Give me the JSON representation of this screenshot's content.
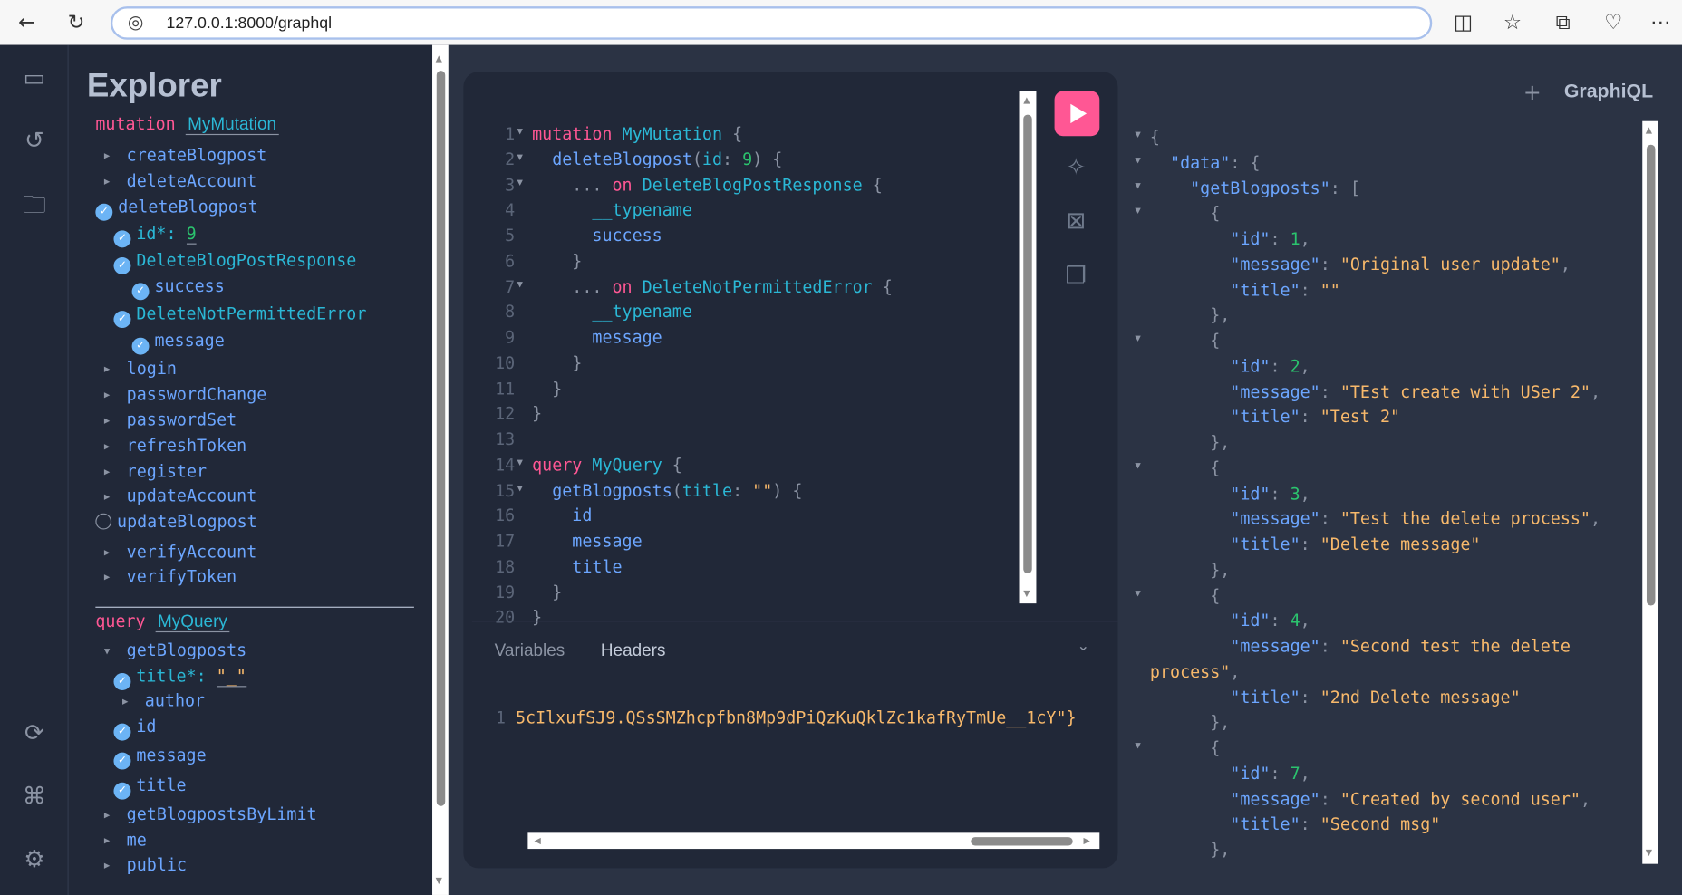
{
  "browser": {
    "url": "127.0.0.1:8000/graphql",
    "icons": [
      "back-arrow-icon",
      "reload-icon",
      "globe-icon",
      "split-screen-icon",
      "favorites-icon",
      "collections-icon",
      "browser-essentials-icon",
      "more-icon"
    ]
  },
  "sidebar": {
    "icons": [
      "docs-icon",
      "history-icon",
      "explorer-icon",
      "refetch-schema-icon",
      "shortcuts-icon",
      "settings-icon"
    ]
  },
  "explorer": {
    "title": "Explorer",
    "mutation": {
      "keyword": "mutation",
      "name": "MyMutation"
    },
    "mutation_items": [
      {
        "label": "createBlogpost",
        "state": "collapsed",
        "level": 0
      },
      {
        "label": "deleteAccount",
        "state": "collapsed",
        "level": 0
      },
      {
        "label": "deleteBlogpost",
        "state": "checked",
        "level": 0
      },
      {
        "label": "id*: ",
        "value": "9",
        "state": "checked",
        "level": 1,
        "arg": true
      },
      {
        "label": "DeleteBlogPostResponse",
        "state": "checked",
        "level": 1,
        "type": true
      },
      {
        "label": "success",
        "state": "checked",
        "level": 2
      },
      {
        "label": "DeleteNotPermittedError",
        "state": "checked",
        "level": 1,
        "type": true
      },
      {
        "label": "message",
        "state": "checked",
        "level": 2
      },
      {
        "label": "login",
        "state": "collapsed",
        "level": 0
      },
      {
        "label": "passwordChange",
        "state": "collapsed",
        "level": 0
      },
      {
        "label": "passwordSet",
        "state": "collapsed",
        "level": 0
      },
      {
        "label": "refreshToken",
        "state": "collapsed",
        "level": 0
      },
      {
        "label": "register",
        "state": "collapsed",
        "level": 0
      },
      {
        "label": "updateAccount",
        "state": "collapsed",
        "level": 0
      },
      {
        "label": "updateBlogpost",
        "state": "unchecked",
        "level": 0
      },
      {
        "label": "verifyAccount",
        "state": "collapsed",
        "level": 0
      },
      {
        "label": "verifyToken",
        "state": "collapsed",
        "level": 0
      }
    ],
    "query": {
      "keyword": "query",
      "name": "MyQuery"
    },
    "query_items": [
      {
        "label": "getBlogposts",
        "state": "expanded",
        "level": 0
      },
      {
        "label": "title*: ",
        "value": "\"_\"",
        "state": "checked",
        "level": 1,
        "arg": true
      },
      {
        "label": "author",
        "state": "collapsed",
        "level": 1
      },
      {
        "label": "id",
        "state": "checked",
        "level": 1
      },
      {
        "label": "message",
        "state": "checked",
        "level": 1
      },
      {
        "label": "title",
        "state": "checked",
        "level": 1
      },
      {
        "label": "getBlogpostsByLimit",
        "state": "collapsed",
        "level": 0
      },
      {
        "label": "me",
        "state": "collapsed",
        "level": 0
      },
      {
        "label": "public",
        "state": "collapsed",
        "level": 0
      }
    ]
  },
  "editor": {
    "lines": [
      {
        "fold": true,
        "tokens": [
          [
            "kw",
            "mutation"
          ],
          [
            "pn",
            " "
          ],
          [
            "nm",
            "MyMutation"
          ],
          [
            "pn",
            " {"
          ]
        ]
      },
      {
        "fold": true,
        "tokens": [
          [
            "pn",
            "  "
          ],
          [
            "fld",
            "deleteBlogpost"
          ],
          [
            "pn",
            "("
          ],
          [
            "arg",
            "id"
          ],
          [
            "pn",
            ": "
          ],
          [
            "num",
            "9"
          ],
          [
            "pn",
            ") {"
          ]
        ]
      },
      {
        "fold": true,
        "tokens": [
          [
            "pn",
            "    ... "
          ],
          [
            "kw",
            "on"
          ],
          [
            "pn",
            " "
          ],
          [
            "nm",
            "DeleteBlogPostResponse"
          ],
          [
            "pn",
            " {"
          ]
        ]
      },
      {
        "fold": false,
        "tokens": [
          [
            "pn",
            "      "
          ],
          [
            "nm",
            "__typename"
          ]
        ]
      },
      {
        "fold": false,
        "tokens": [
          [
            "pn",
            "      "
          ],
          [
            "fld",
            "success"
          ]
        ]
      },
      {
        "fold": false,
        "tokens": [
          [
            "pn",
            "    }"
          ]
        ]
      },
      {
        "fold": true,
        "tokens": [
          [
            "pn",
            "    ... "
          ],
          [
            "kw",
            "on"
          ],
          [
            "pn",
            " "
          ],
          [
            "nm",
            "DeleteNotPermittedError"
          ],
          [
            "pn",
            " {"
          ]
        ]
      },
      {
        "fold": false,
        "tokens": [
          [
            "pn",
            "      "
          ],
          [
            "nm",
            "__typename"
          ]
        ]
      },
      {
        "fold": false,
        "tokens": [
          [
            "pn",
            "      "
          ],
          [
            "fld",
            "message"
          ]
        ]
      },
      {
        "fold": false,
        "tokens": [
          [
            "pn",
            "    }"
          ]
        ]
      },
      {
        "fold": false,
        "tokens": [
          [
            "pn",
            "  }"
          ]
        ]
      },
      {
        "fold": false,
        "tokens": [
          [
            "pn",
            "}"
          ]
        ]
      },
      {
        "fold": false,
        "tokens": []
      },
      {
        "fold": true,
        "tokens": [
          [
            "kw",
            "query"
          ],
          [
            "pn",
            " "
          ],
          [
            "nm",
            "MyQuery"
          ],
          [
            "pn",
            " {"
          ]
        ]
      },
      {
        "fold": true,
        "tokens": [
          [
            "pn",
            "  "
          ],
          [
            "fld",
            "getBlogposts"
          ],
          [
            "pn",
            "("
          ],
          [
            "arg",
            "title"
          ],
          [
            "pn",
            ": "
          ],
          [
            "str",
            "\"\""
          ],
          [
            "pn",
            ") {"
          ]
        ]
      },
      {
        "fold": false,
        "tokens": [
          [
            "pn",
            "    "
          ],
          [
            "fld",
            "id"
          ]
        ]
      },
      {
        "fold": false,
        "tokens": [
          [
            "pn",
            "    "
          ],
          [
            "fld",
            "message"
          ]
        ]
      },
      {
        "fold": false,
        "tokens": [
          [
            "pn",
            "    "
          ],
          [
            "fld",
            "title"
          ]
        ]
      },
      {
        "fold": false,
        "tokens": [
          [
            "pn",
            "  }"
          ]
        ]
      },
      {
        "fold": false,
        "tokens": [
          [
            "pn",
            "}"
          ]
        ]
      }
    ],
    "toolbar": {
      "run": "run-icon",
      "prettify": "prettify-icon",
      "merge": "merge-fragments-icon",
      "copy": "copy-icon"
    },
    "tabs": [
      "Variables",
      "Headers"
    ],
    "headers_line_number": "1",
    "headers_text": "5cIlxufSJ9.QSsSMZhcpfbn8Mp9dPiQzKuQklZc1kafRyTmUe__1cY\"}"
  },
  "results": {
    "add_tab": "+",
    "logo": "GraphiQL",
    "lines": [
      {
        "fold": true,
        "tokens": [
          [
            "pn",
            "{"
          ]
        ]
      },
      {
        "fold": true,
        "tokens": [
          [
            "pn",
            "  "
          ],
          [
            "key",
            "\"data\""
          ],
          [
            "pn",
            ": {"
          ]
        ]
      },
      {
        "fold": true,
        "tokens": [
          [
            "pn",
            "    "
          ],
          [
            "key",
            "\"getBlogposts\""
          ],
          [
            "pn",
            ": ["
          ]
        ]
      },
      {
        "fold": true,
        "tokens": [
          [
            "pn",
            "      {"
          ]
        ]
      },
      {
        "fold": false,
        "tokens": [
          [
            "pn",
            "        "
          ],
          [
            "key",
            "\"id\""
          ],
          [
            "pn",
            ": "
          ],
          [
            "num",
            "1"
          ],
          [
            "pn",
            ","
          ]
        ]
      },
      {
        "fold": false,
        "tokens": [
          [
            "pn",
            "        "
          ],
          [
            "key",
            "\"message\""
          ],
          [
            "pn",
            ": "
          ],
          [
            "str",
            "\"Original user update\""
          ],
          [
            "pn",
            ","
          ]
        ]
      },
      {
        "fold": false,
        "tokens": [
          [
            "pn",
            "        "
          ],
          [
            "key",
            "\"title\""
          ],
          [
            "pn",
            ": "
          ],
          [
            "str",
            "\"\""
          ]
        ]
      },
      {
        "fold": false,
        "tokens": [
          [
            "pn",
            "      },"
          ]
        ]
      },
      {
        "fold": true,
        "tokens": [
          [
            "pn",
            "      {"
          ]
        ]
      },
      {
        "fold": false,
        "tokens": [
          [
            "pn",
            "        "
          ],
          [
            "key",
            "\"id\""
          ],
          [
            "pn",
            ": "
          ],
          [
            "num",
            "2"
          ],
          [
            "pn",
            ","
          ]
        ]
      },
      {
        "fold": false,
        "tokens": [
          [
            "pn",
            "        "
          ],
          [
            "key",
            "\"message\""
          ],
          [
            "pn",
            ": "
          ],
          [
            "str",
            "\"TEst create with USer 2\""
          ],
          [
            "pn",
            ","
          ]
        ]
      },
      {
        "fold": false,
        "tokens": [
          [
            "pn",
            "        "
          ],
          [
            "key",
            "\"title\""
          ],
          [
            "pn",
            ": "
          ],
          [
            "str",
            "\"Test 2\""
          ]
        ]
      },
      {
        "fold": false,
        "tokens": [
          [
            "pn",
            "      },"
          ]
        ]
      },
      {
        "fold": true,
        "tokens": [
          [
            "pn",
            "      {"
          ]
        ]
      },
      {
        "fold": false,
        "tokens": [
          [
            "pn",
            "        "
          ],
          [
            "key",
            "\"id\""
          ],
          [
            "pn",
            ": "
          ],
          [
            "num",
            "3"
          ],
          [
            "pn",
            ","
          ]
        ]
      },
      {
        "fold": false,
        "tokens": [
          [
            "pn",
            "        "
          ],
          [
            "key",
            "\"message\""
          ],
          [
            "pn",
            ": "
          ],
          [
            "str",
            "\"Test the delete process\""
          ],
          [
            "pn",
            ","
          ]
        ]
      },
      {
        "fold": false,
        "tokens": [
          [
            "pn",
            "        "
          ],
          [
            "key",
            "\"title\""
          ],
          [
            "pn",
            ": "
          ],
          [
            "str",
            "\"Delete message\""
          ]
        ]
      },
      {
        "fold": false,
        "tokens": [
          [
            "pn",
            "      },"
          ]
        ]
      },
      {
        "fold": true,
        "tokens": [
          [
            "pn",
            "      {"
          ]
        ]
      },
      {
        "fold": false,
        "tokens": [
          [
            "pn",
            "        "
          ],
          [
            "key",
            "\"id\""
          ],
          [
            "pn",
            ": "
          ],
          [
            "num",
            "4"
          ],
          [
            "pn",
            ","
          ]
        ]
      },
      {
        "fold": false,
        "tokens": [
          [
            "pn",
            "        "
          ],
          [
            "key",
            "\"message\""
          ],
          [
            "pn",
            ": "
          ],
          [
            "str",
            "\"Second test the delete"
          ]
        ]
      },
      {
        "fold": false,
        "tokens": [
          [
            "str",
            "process\""
          ],
          [
            "pn",
            ","
          ]
        ]
      },
      {
        "fold": false,
        "tokens": [
          [
            "pn",
            "        "
          ],
          [
            "key",
            "\"title\""
          ],
          [
            "pn",
            ": "
          ],
          [
            "str",
            "\"2nd Delete message\""
          ]
        ]
      },
      {
        "fold": false,
        "tokens": [
          [
            "pn",
            "      },"
          ]
        ]
      },
      {
        "fold": true,
        "tokens": [
          [
            "pn",
            "      {"
          ]
        ]
      },
      {
        "fold": false,
        "tokens": [
          [
            "pn",
            "        "
          ],
          [
            "key",
            "\"id\""
          ],
          [
            "pn",
            ": "
          ],
          [
            "num",
            "7"
          ],
          [
            "pn",
            ","
          ]
        ]
      },
      {
        "fold": false,
        "tokens": [
          [
            "pn",
            "        "
          ],
          [
            "key",
            "\"message\""
          ],
          [
            "pn",
            ": "
          ],
          [
            "str",
            "\"Created by second user\""
          ],
          [
            "pn",
            ","
          ]
        ]
      },
      {
        "fold": false,
        "tokens": [
          [
            "pn",
            "        "
          ],
          [
            "key",
            "\"title\""
          ],
          [
            "pn",
            ": "
          ],
          [
            "str",
            "\"Second msg\""
          ]
        ]
      },
      {
        "fold": false,
        "tokens": [
          [
            "pn",
            "      },"
          ]
        ]
      }
    ]
  },
  "colors": {
    "run": "#ff5794",
    "keyword": "#ff5794",
    "name": "#2bb8d6",
    "field": "#6ca6ff",
    "string": "#f8b96b",
    "number": "#2bc46e",
    "background": "#212838"
  }
}
